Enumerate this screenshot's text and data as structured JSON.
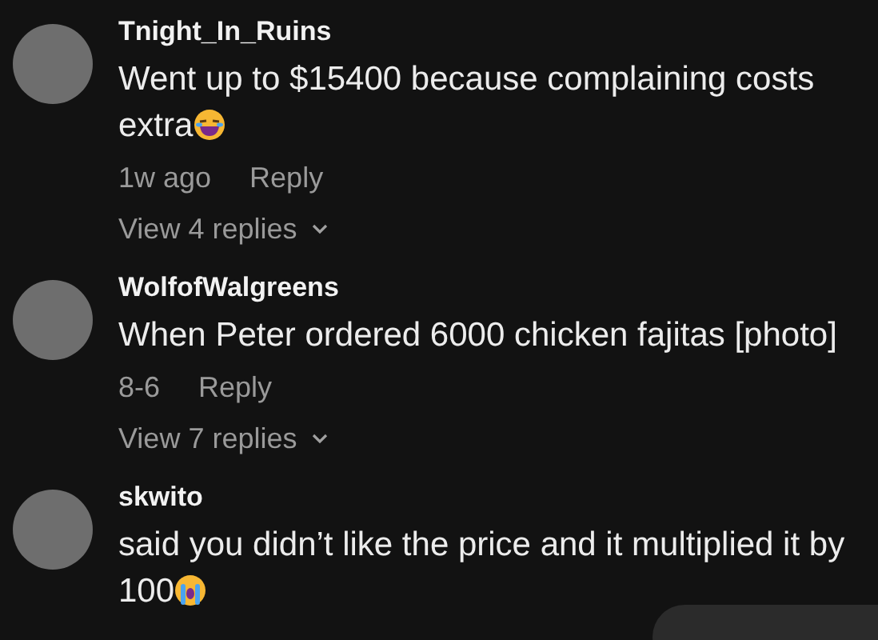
{
  "comments": [
    {
      "username": "Tnight_In_Ruins",
      "text": "Went up to $15400 because complaining costs extra",
      "emoji": {
        "kind": "laughing"
      },
      "time": "1w ago",
      "reply": "Reply",
      "view_replies": "View 4 replies"
    },
    {
      "username": "WolfofWalgreens",
      "text": "When Peter ordered 6000 chicken fajitas [photo]",
      "time": "8-6",
      "reply": "Reply",
      "view_replies": "View 7 replies"
    },
    {
      "username": "skwito",
      "text": "said you didn’t like the price and it multiplied it by 100",
      "emoji": {
        "kind": "crying"
      }
    }
  ]
}
